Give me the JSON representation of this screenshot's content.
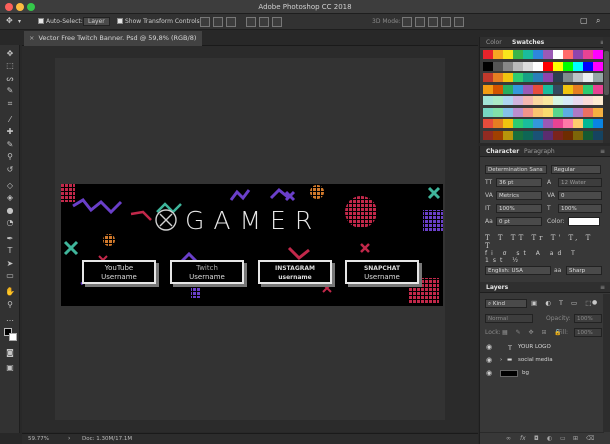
{
  "window": {
    "title": "Adobe Photoshop CC 2018"
  },
  "options_bar": {
    "auto_select_label": "Auto-Select:",
    "auto_select_value": "Layer",
    "transform_controls_label": "Show Transform Controls",
    "mode_3d_label": "3D Mode:"
  },
  "document": {
    "tab_title": "Vector Free Twitch Banner. Psd @ 59,8% (RGB/8)",
    "zoom": "59.77%",
    "doc_size": "Doc: 1.30M/17.1M"
  },
  "banner": {
    "title": "GAMER",
    "boxes": [
      {
        "top": "YouTube",
        "bottom": "Username"
      },
      {
        "top": "Twitch",
        "bottom": "Username"
      },
      {
        "top": "INSTAGRAM",
        "bottom": "username"
      },
      {
        "top": "SNAPCHAT",
        "bottom": "Username"
      }
    ]
  },
  "swatches_panel": {
    "tabs": [
      "Color",
      "Swatches"
    ],
    "active_tab": "Swatches"
  },
  "character_panel": {
    "tabs": [
      "Character",
      "Paragraph"
    ],
    "active_tab": "Character",
    "font_family": "Determination Sans",
    "font_style": "Regular",
    "font_size": "36 pt",
    "leading": "12 Water",
    "kerning": "Metrics",
    "tracking": "0",
    "vertical_scale": "100%",
    "horizontal_scale": "100%",
    "baseline_shift": "0 pt",
    "color_label": "Color:",
    "language": "English: USA",
    "antialias": "Sharp",
    "glyphs": "T T TT Tr T' T, T T"
  },
  "layers_panel": {
    "title": "Layers",
    "filter_kind": "Kind",
    "blend_mode": "Normal",
    "opacity_label": "Opacity:",
    "opacity_value": "100%",
    "lock_label": "Lock:",
    "fill_label": "Fill:",
    "fill_value": "100%",
    "layers": [
      {
        "name": "YOUR LOGO",
        "type": "text"
      },
      {
        "name": "social media",
        "type": "group"
      },
      {
        "name": "bg",
        "type": "pixel"
      }
    ],
    "footer_icons": [
      "link-icon",
      "fx-icon",
      "mask-icon",
      "adjustment-icon",
      "folder-icon",
      "new-layer-icon",
      "trash-icon"
    ]
  },
  "colors": {
    "banner_bg": "#000000",
    "accent_purple": "#6a3fc9",
    "accent_red": "#c2284a",
    "accent_green": "#3fb59b",
    "accent_orange": "#d27a2c"
  }
}
